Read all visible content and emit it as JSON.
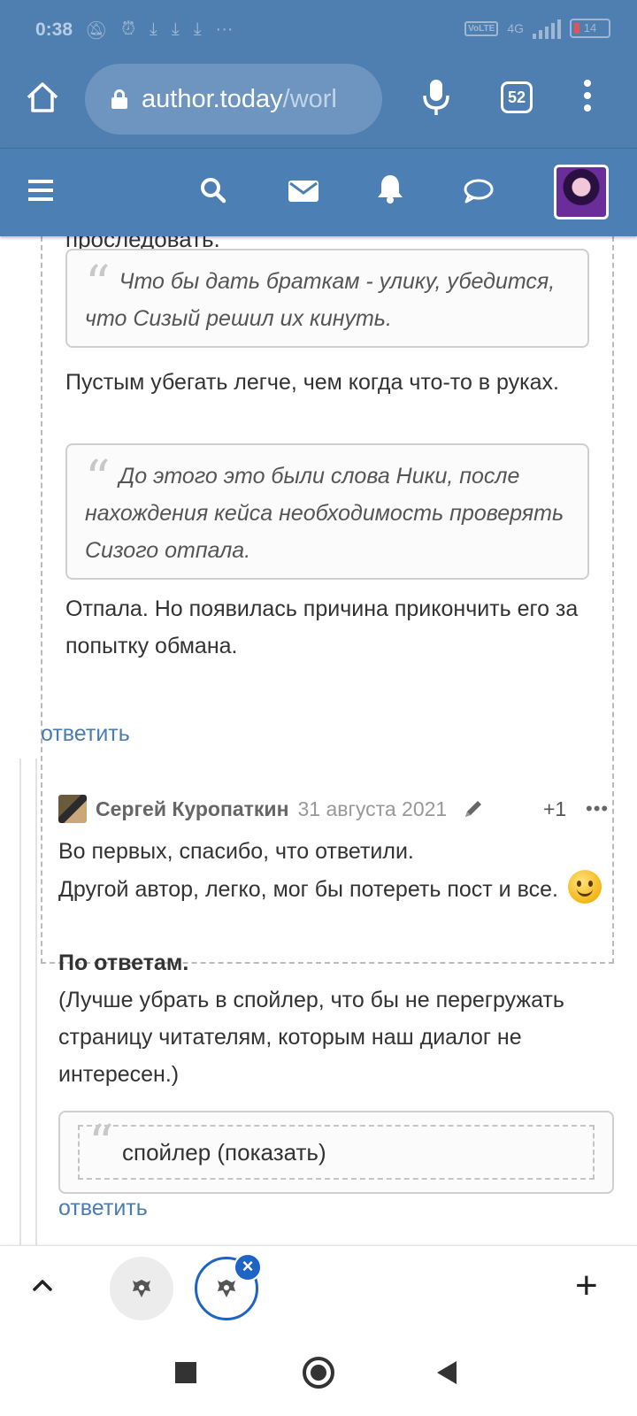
{
  "status_bar": {
    "time": "0:38",
    "network": "4G",
    "vowifi": "VoLTE",
    "battery": "14"
  },
  "browser": {
    "url_main": "author.today",
    "url_rest": "/worl",
    "tab_count": "52"
  },
  "content": {
    "cut_line_text": "проследовать.",
    "quote1": "Что бы дать браткам - улику, убедится, что Сизый решил их кинуть.",
    "para1": "Пустым убегать легче, чем когда что-то в руках.",
    "quote2": "До этого это были слова Ники, после нахождения кейса необходимость проверять Сизого отпала.",
    "para2": "Отпала. Но появилась причина прикончить его за попытку обмана.",
    "reply_label": "ответить"
  },
  "comment": {
    "author": "Сергей Куропаткин",
    "date": "31 августа 2021",
    "rating": "+1",
    "more": "•••",
    "line1": "Во первых, спасибо, что ответили.",
    "line2": "Другой автор, легко, мог бы потереть пост и все.",
    "bold": "По ответам.",
    "line3": "(Лучше убрать в спойлер, что бы не перегружать страницу читателям, которым наш диалог не  интересен.)",
    "spoiler": "спойлер (показать)",
    "reply_label": "ответить"
  },
  "colors": {
    "header_blue": "#4f7fb1",
    "link_blue": "#4a7cb0",
    "tab_active": "#1d64c4"
  }
}
